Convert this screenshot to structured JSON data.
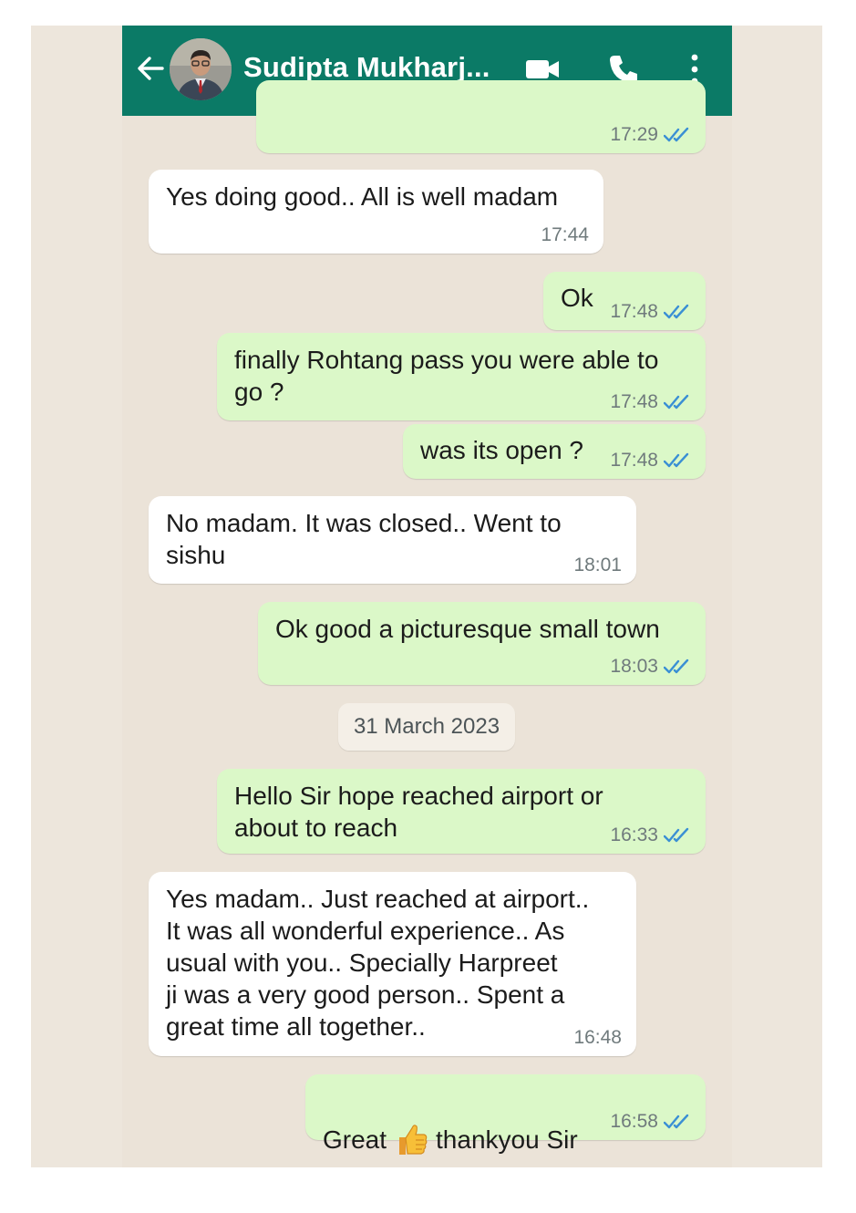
{
  "header": {
    "contact_name": "Sudipta Mukharj...",
    "color": "#0b7a66"
  },
  "date_divider": "31 March 2023",
  "messages": [
    {
      "direction": "out",
      "text": "",
      "time": "17:29",
      "read": true
    },
    {
      "direction": "in",
      "text": "Yes doing good.. All is well madam",
      "time": "17:44"
    },
    {
      "direction": "out",
      "text": "Ok",
      "time": "17:48",
      "read": true
    },
    {
      "direction": "out",
      "text": "finally Rohtang pass you were able to\ngo ?",
      "time": "17:48",
      "read": true
    },
    {
      "direction": "out",
      "text": "was its open ?",
      "time": "17:48",
      "read": true
    },
    {
      "direction": "in",
      "text": "No madam. It was closed.. Went to\nsishu",
      "time": "18:01"
    },
    {
      "direction": "out",
      "text": "Ok good a picturesque small town",
      "time": "18:03",
      "read": true
    },
    {
      "direction": "out",
      "text": "Hello Sir hope  reached airport or\nabout to reach",
      "time": "16:33",
      "read": true
    },
    {
      "direction": "in",
      "text": "Yes madam.. Just reached at airport..\nIt was all wonderful experience.. As\nusual with you.. Specially Harpreet\nji was a very good person.. Spent a\ngreat time all together..",
      "time": "16:48"
    },
    {
      "direction": "out",
      "text_before_emoji": "Great",
      "emoji": "thumbs-up",
      "text_after_emoji": "thankyou Sir",
      "time": "16:58",
      "read": true
    }
  ],
  "colors": {
    "incoming_bubble": "#ffffff",
    "outgoing_bubble": "#dbf8c8",
    "read_tick": "#3a8fd4",
    "chat_background": "#ebe3d8"
  }
}
